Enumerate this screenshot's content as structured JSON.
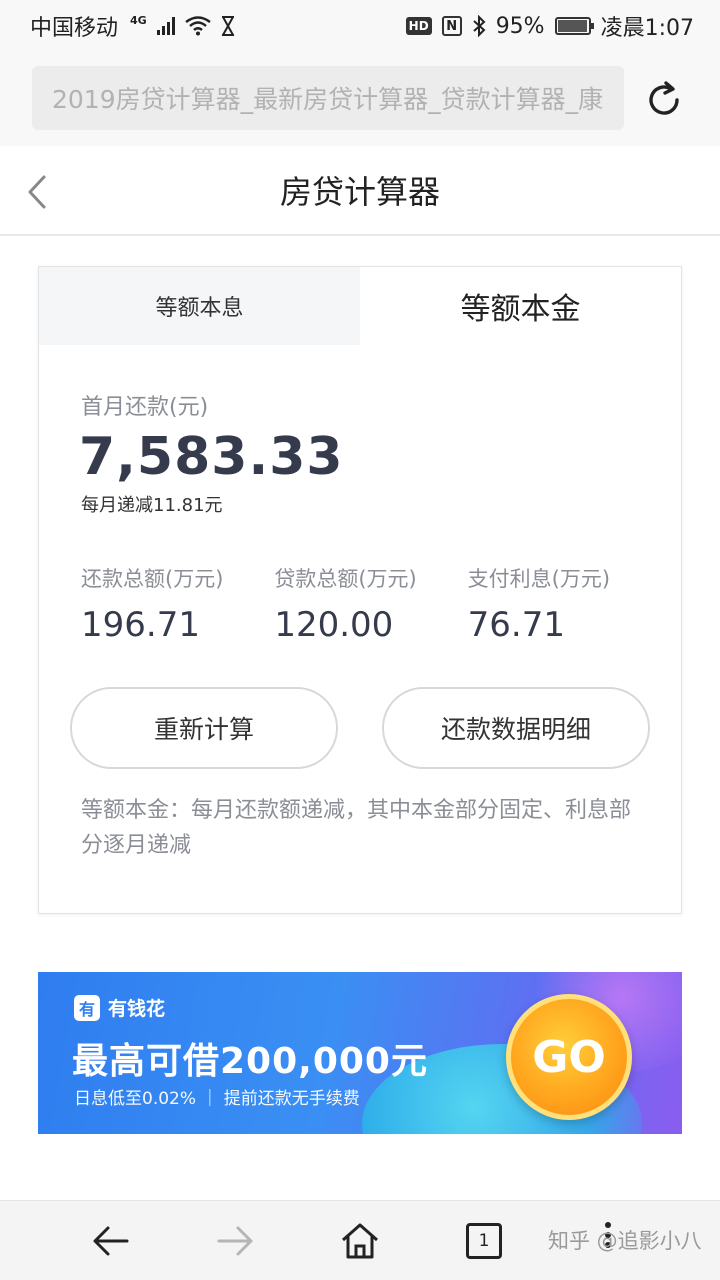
{
  "status_bar": {
    "carrier": "中国移动",
    "network": "4G",
    "battery": "95%",
    "time": "凌晨1:07",
    "hd": "HD",
    "nfc": "N"
  },
  "browser": {
    "url_title": "2019房贷计算器_最新房贷计算器_贷款计算器_康"
  },
  "header": {
    "title": "房贷计算器"
  },
  "tabs": [
    {
      "label": "等额本息",
      "active": false
    },
    {
      "label": "等额本金",
      "active": true
    }
  ],
  "result": {
    "first_month_label": "首月还款(元)",
    "first_month_value": "7,583.33",
    "monthly_decrease": "每月递减11.81元",
    "stats": [
      {
        "label": "还款总额(万元)",
        "value": "196.71"
      },
      {
        "label": "贷款总额(万元)",
        "value": "120.00"
      },
      {
        "label": "支付利息(万元)",
        "value": "76.71"
      }
    ]
  },
  "buttons": {
    "recalculate": "重新计算",
    "detail": "还款数据明细"
  },
  "description": "等额本金：每月还款额递减，其中本金部分固定、利息部分逐月递减",
  "ad": {
    "brand_logo": "有",
    "brand": "有钱花",
    "headline": "最高可借200,000元",
    "sub": "日息低至0.02% ｜ 提前还款无手续费",
    "go": "GO"
  },
  "bottom_nav": {
    "tab_count": "1",
    "watermark": "知乎 @追影小八"
  },
  "colors": {
    "value_text": "#353b4d",
    "muted_text": "#8b8e96",
    "ad_blue": "#2f7df0",
    "go_orange": "#ffa21c"
  },
  "icons": [
    "reload-icon",
    "back-chevron-icon",
    "nav-back-icon",
    "nav-forward-icon",
    "home-icon",
    "tabs-count-icon",
    "more-menu-icon",
    "wifi-icon",
    "signal-icon",
    "bluetooth-icon",
    "battery-icon",
    "hourglass-icon"
  ]
}
